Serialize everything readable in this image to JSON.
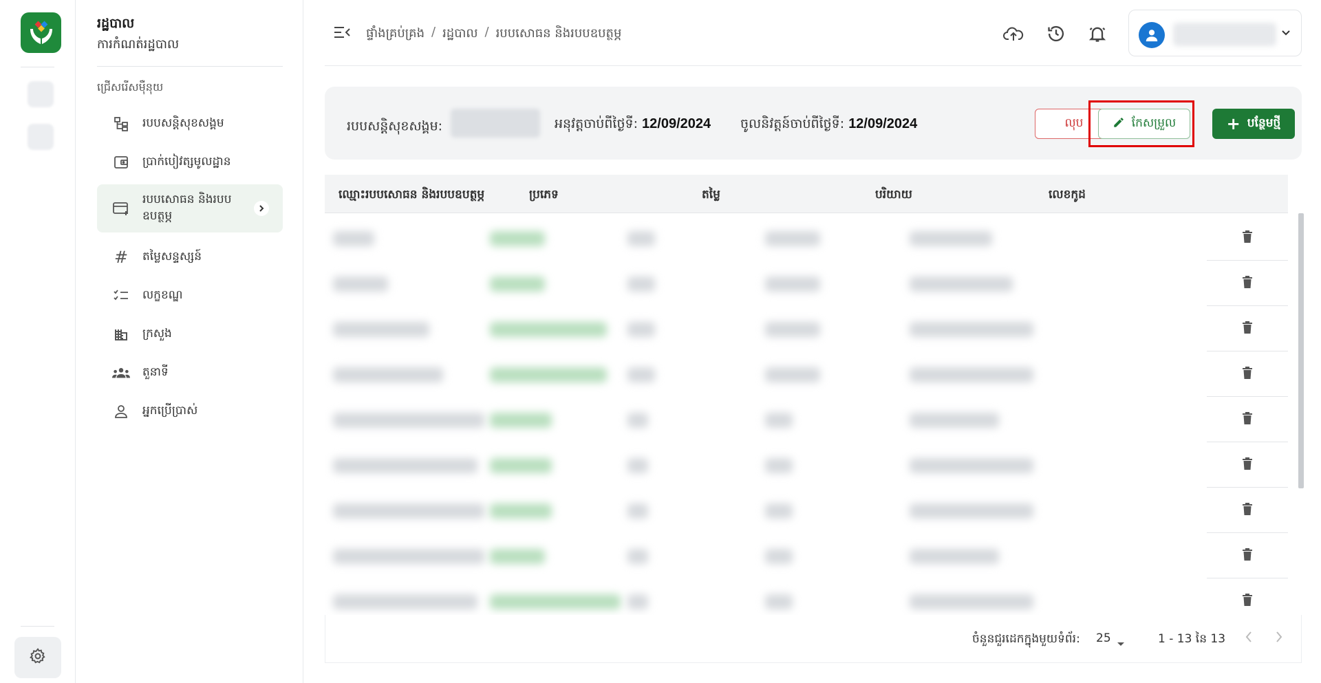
{
  "rail": {
    "logo": "hands-logo-icon",
    "settings_icon": "gear-icon"
  },
  "sidebar": {
    "title": "រដ្ឋបាល",
    "subtitle": "ការកំណត់រដ្ឋបាល",
    "section_label": "ជ្រើសរើសម៉ឺនុយ",
    "items": [
      {
        "label": "របបសន្តិសុខសង្គម",
        "icon": "hierarchy-icon"
      },
      {
        "label": "ប្រាក់បៀវត្សមូលដ្ឋាន",
        "icon": "wallet-icon"
      },
      {
        "label": "របបសោធន និងរបបឧបត្ថម្ភ",
        "icon": "card-add-icon",
        "active": true
      },
      {
        "label": "តម្លៃសន្ទស្សន៍",
        "icon": "hash-icon"
      },
      {
        "label": "លក្ខខណ្ឌ",
        "icon": "checklist-icon"
      },
      {
        "label": "ក្រសួង",
        "icon": "building-icon"
      },
      {
        "label": "តួនាទី",
        "icon": "group-icon"
      },
      {
        "label": "អ្នកប្រើប្រាស់",
        "icon": "user-icon"
      }
    ]
  },
  "topbar": {
    "breadcrumb": [
      "ផ្ទាំងគ្រប់គ្រង",
      "រដ្ឋបាល",
      "របបសោធន និងរបបឧបត្ថម្ភ"
    ],
    "separator": "/",
    "icons": [
      "cloud-upload-icon",
      "history-icon",
      "bell-icon"
    ]
  },
  "infobar": {
    "scheme_label": "របបសន្តិសុខសង្គម:",
    "effective_label": "អនុវត្តចាប់ពីថ្ងៃទី:",
    "effective_date": "12/09/2024",
    "entry_label": "ចូលនិវត្តន៍ចាប់ពីថ្ងៃទី:",
    "entry_date": "12/09/2024",
    "delete_label": "លុប",
    "edit_label": "កែសម្រួល",
    "add_label": "បន្ថែមថ្មី"
  },
  "table": {
    "headers": [
      "ឈ្មោះរបបសោធន និងរបបឧបត្ថម្ភ",
      "ប្រភេទ",
      "តម្លៃ",
      "បរិយាយ",
      "លេខកូដ"
    ],
    "row_count": 9
  },
  "pagination": {
    "rows_label": "ចំនួនជួរដេកក្នុងមួយទំព័រ:",
    "rows_per_page": "25",
    "range": "1 - 13 នៃ 13"
  }
}
